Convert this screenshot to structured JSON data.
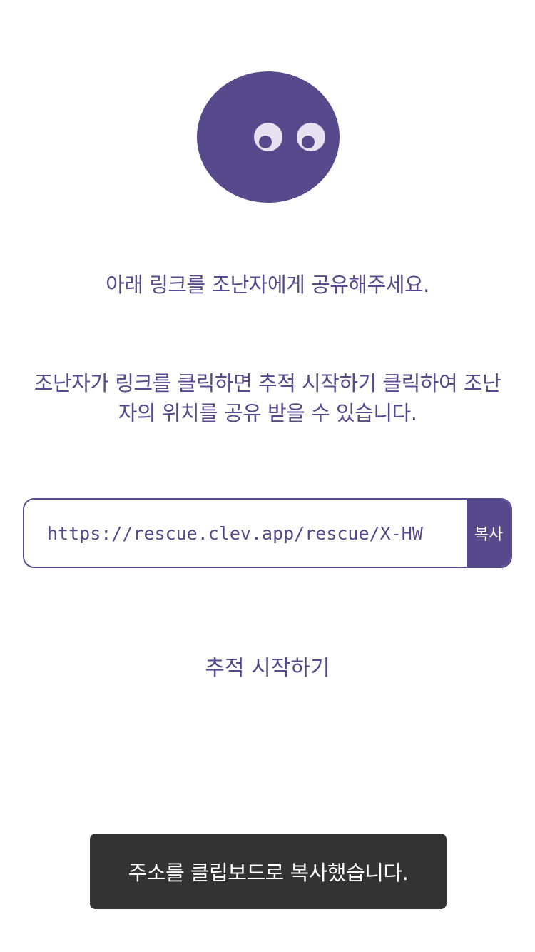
{
  "colors": {
    "accent": "#574a8c",
    "eye_white": "#e6e0f0",
    "toast_bg": "#333333",
    "toast_text": "#ffffff"
  },
  "mascot": {
    "icon": "purple-blob-mascot-icon"
  },
  "instructions": {
    "share_prompt": "아래 링크를 조난자에게 공유해주세요.",
    "description": "조난자가 링크를 클릭하면 추적 시작하기 클릭하여 조난자의 위치를 공유 받을 수 있습니다."
  },
  "share_link": {
    "url": "https://rescue.clev.app/rescue/X-HW",
    "copy_label": "복사"
  },
  "actions": {
    "start_tracking_label": "추적 시작하기"
  },
  "toast": {
    "message": "주소를 클립보드로 복사했습니다."
  }
}
